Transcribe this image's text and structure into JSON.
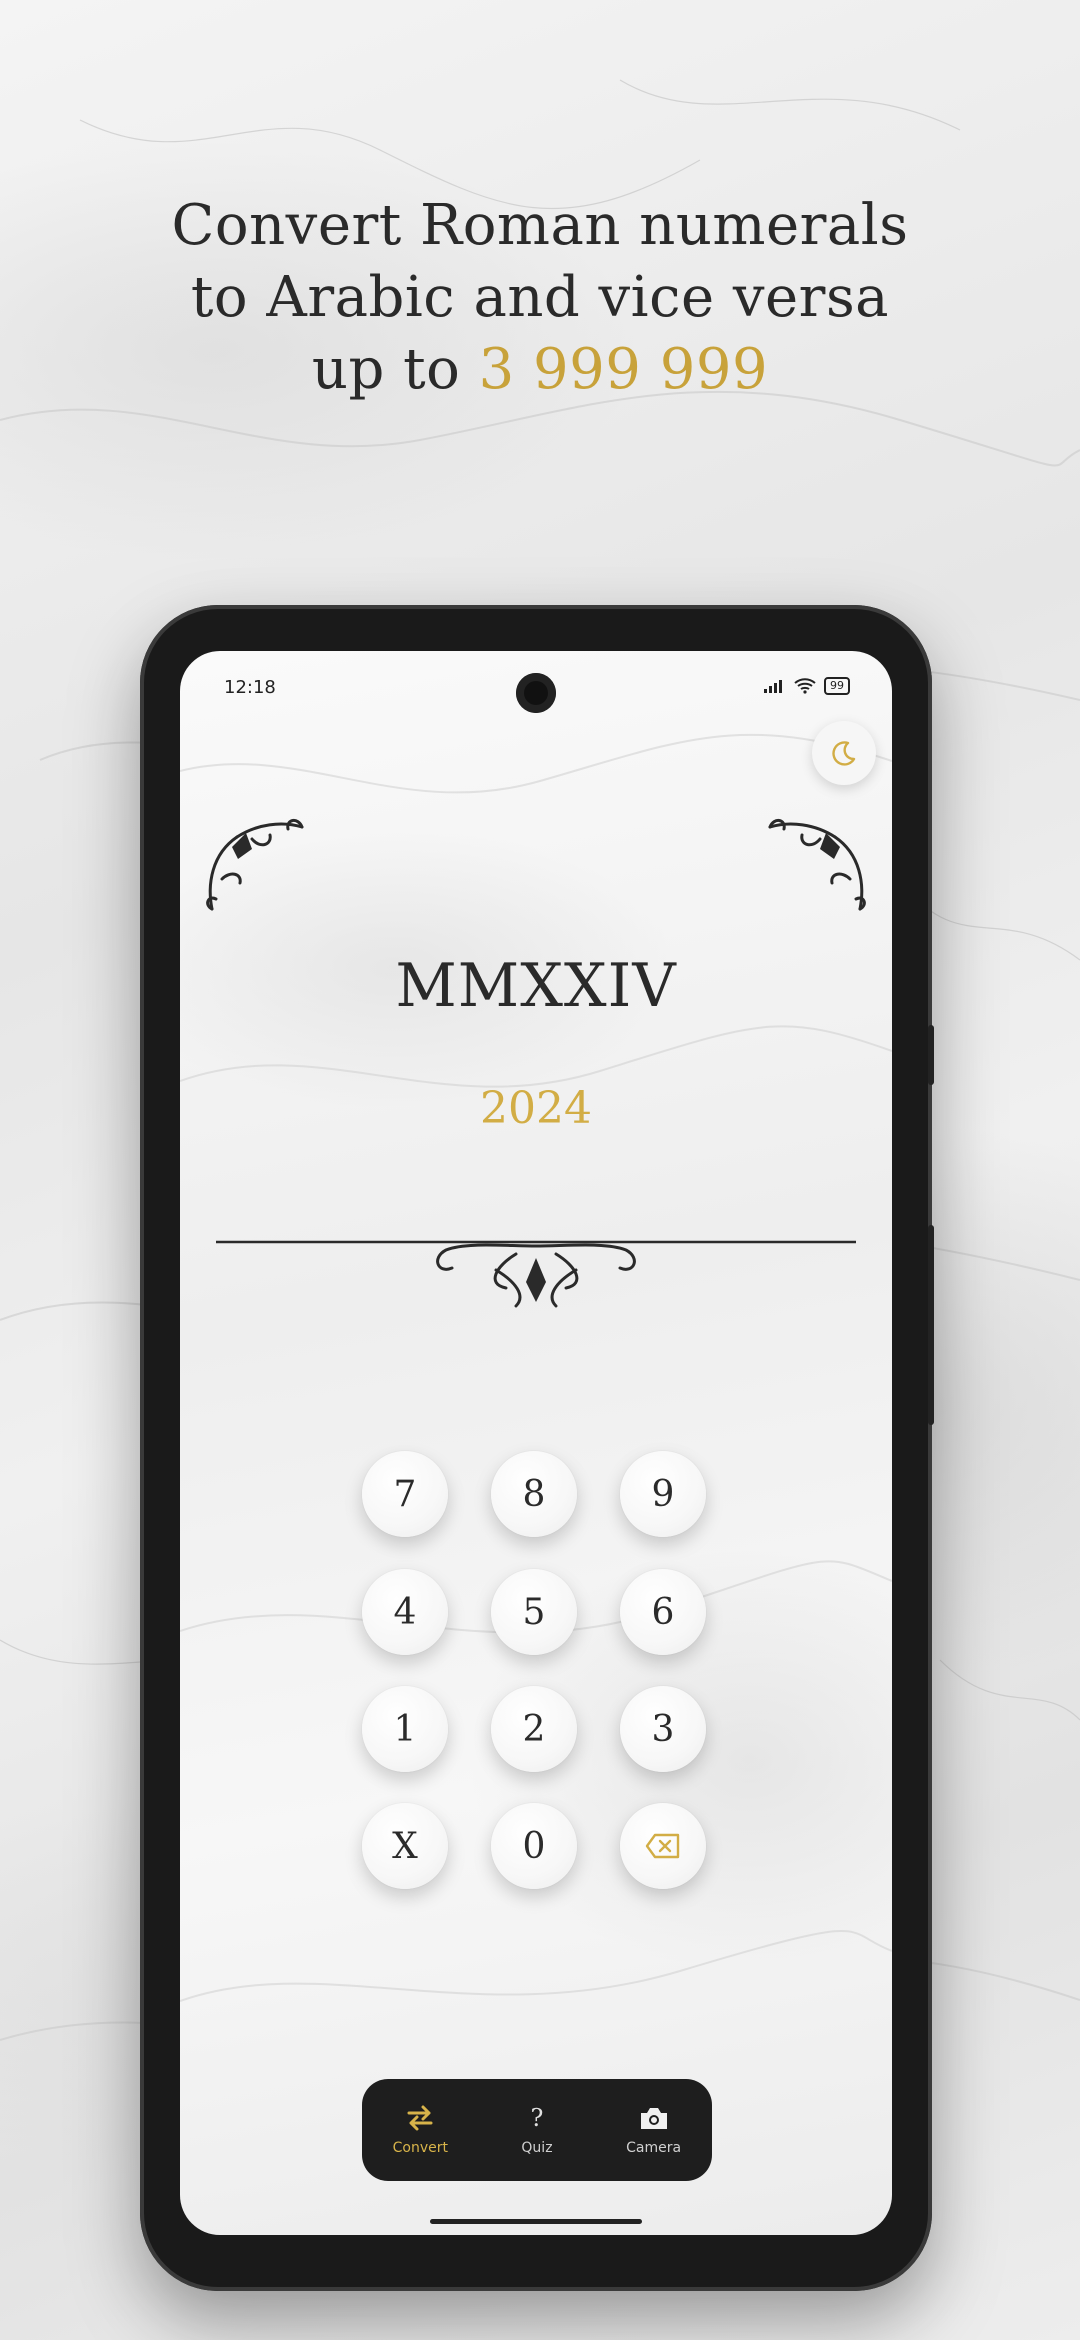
{
  "headline": {
    "line1": "Convert Roman numerals",
    "line2": "to Arabic and vice versa",
    "line3_prefix": "up to ",
    "line3_highlight": "3 999 999"
  },
  "status_bar": {
    "time": "12:18",
    "battery": "99"
  },
  "converter": {
    "roman": "MMXXIV",
    "arabic": "2024"
  },
  "keypad": {
    "keys": [
      "7",
      "8",
      "9",
      "4",
      "5",
      "6",
      "1",
      "2",
      "3",
      "X",
      "0"
    ],
    "backspace_icon": "backspace-icon"
  },
  "nav": {
    "items": [
      {
        "label": "Convert",
        "icon": "swap-icon",
        "active": true
      },
      {
        "label": "Quiz",
        "icon": "question-icon",
        "active": false
      },
      {
        "label": "Camera",
        "icon": "camera-icon",
        "active": false
      }
    ]
  },
  "colors": {
    "gold": "#d2ad45",
    "text": "#2a2a2a",
    "nav_bg": "#1e1e1e"
  }
}
